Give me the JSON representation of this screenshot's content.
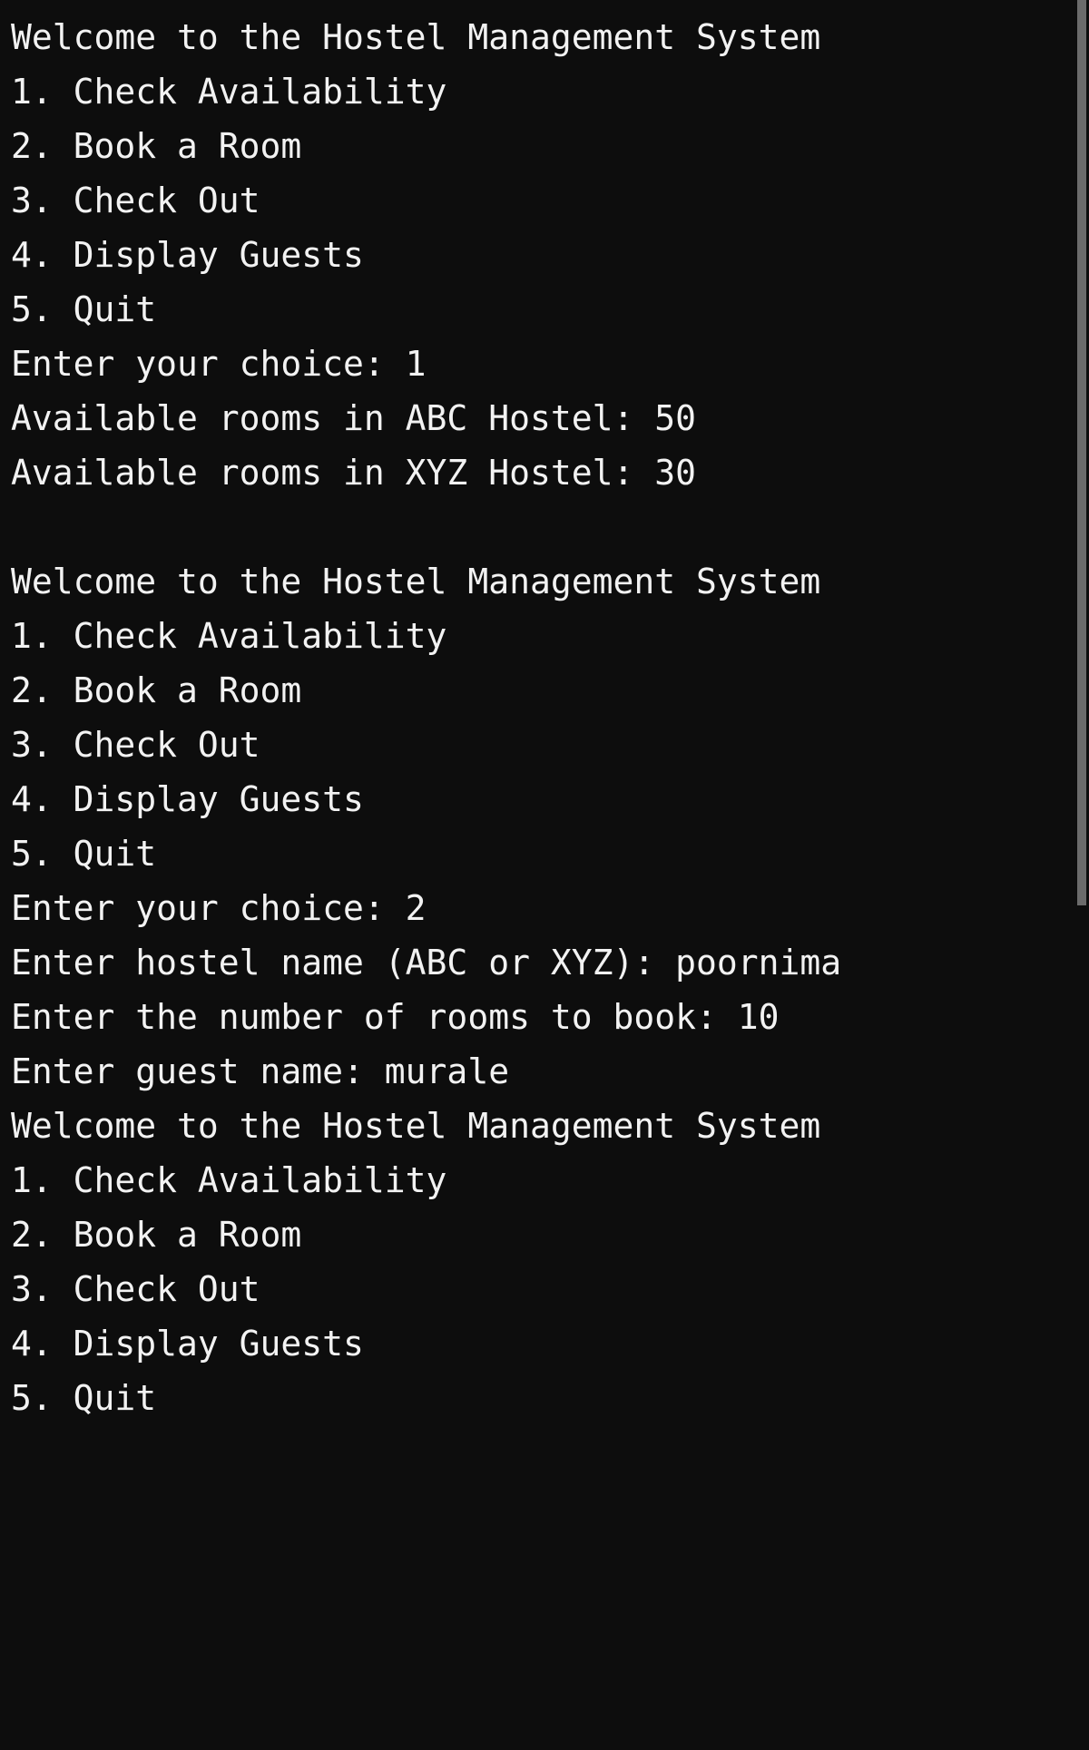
{
  "terminal": {
    "background_color": "#0d0d0d",
    "text_color": "#f2f2f2",
    "scrollbar_thumb_color": "#6b6b6b",
    "lines": [
      "Welcome to the Hostel Management System",
      "1. Check Availability",
      "2. Book a Room",
      "3. Check Out",
      "4. Display Guests",
      "5. Quit",
      "Enter your choice: 1",
      "Available rooms in ABC Hostel: 50",
      "Available rooms in XYZ Hostel: 30",
      "",
      "Welcome to the Hostel Management System",
      "1. Check Availability",
      "2. Book a Room",
      "3. Check Out",
      "4. Display Guests",
      "5. Quit",
      "Enter your choice: 2",
      "Enter hostel name (ABC or XYZ): poornima",
      "Enter the number of rooms to book: 10",
      "Enter guest name: murale",
      "Welcome to the Hostel Management System",
      "1. Check Availability",
      "2. Book a Room",
      "3. Check Out",
      "4. Display Guests",
      "5. Quit"
    ]
  },
  "program": {
    "title": "Welcome to the Hostel Management System",
    "menu": [
      "1. Check Availability",
      "2. Book a Room",
      "3. Check Out",
      "4. Display Guests",
      "5. Quit"
    ],
    "prompts": {
      "choice": "Enter your choice: ",
      "hostel_name": "Enter hostel name (ABC or XYZ): ",
      "rooms_to_book": "Enter the number of rooms to book: ",
      "guest_name": "Enter guest name: "
    },
    "outputs": {
      "available_abc": "Available rooms in ABC Hostel: 50",
      "available_xyz": "Available rooms in XYZ Hostel: 30"
    },
    "user_inputs": {
      "first_choice": "1",
      "second_choice": "2",
      "hostel_name": "poornima",
      "rooms": "10",
      "guest_name": "murale"
    }
  }
}
